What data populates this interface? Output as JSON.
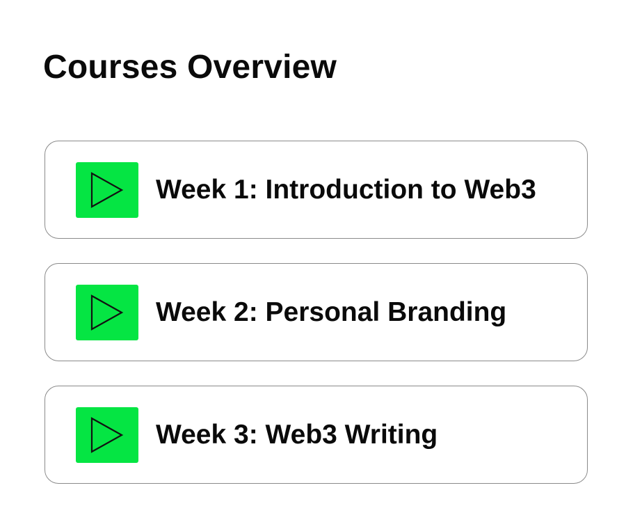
{
  "page": {
    "title": "Courses Overview"
  },
  "theme": {
    "accent": "#05e543",
    "icon_stroke": "#111111",
    "card_border": "#8a8a8a"
  },
  "courses": [
    {
      "label": "Week 1: Introduction to Web3",
      "icon": "play-icon"
    },
    {
      "label": "Week 2: Personal Branding",
      "icon": "play-icon"
    },
    {
      "label": "Week 3: Web3 Writing",
      "icon": "play-icon"
    }
  ]
}
